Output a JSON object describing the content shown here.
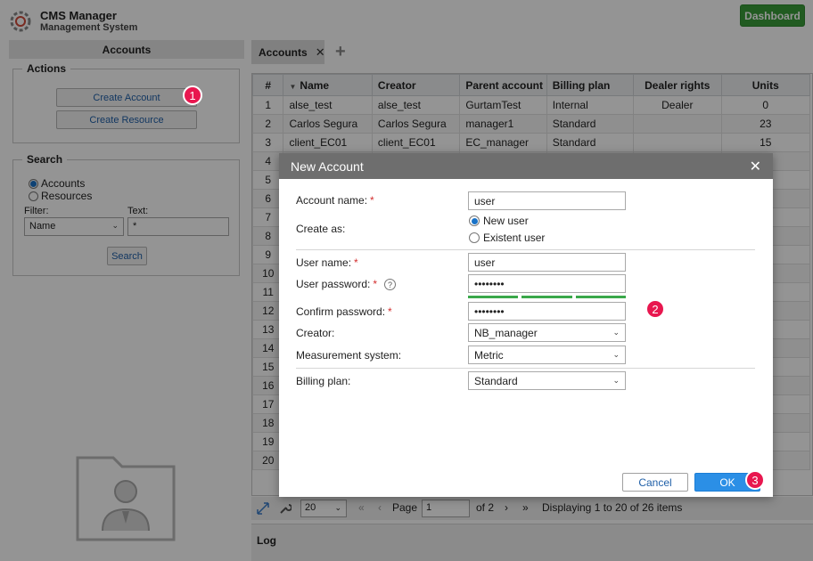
{
  "app": {
    "title": "CMS Manager",
    "subtitle": "Management System",
    "dashboard_label": "Dashboard"
  },
  "left": {
    "header": "Accounts",
    "actions": {
      "legend": "Actions",
      "create_account": "Create Account",
      "create_resource": "Create Resource"
    },
    "search": {
      "legend": "Search",
      "radio_accounts": "Accounts",
      "radio_resources": "Resources",
      "filter_label": "Filter:",
      "text_label": "Text:",
      "filter_value": "Name",
      "text_value": "*",
      "button": "Search"
    }
  },
  "tabs": {
    "accounts": "Accounts",
    "close": "✕",
    "add": "+"
  },
  "table": {
    "columns": [
      "#",
      "Name",
      "Creator",
      "Parent account",
      "Billing plan",
      "Dealer rights",
      "Units"
    ],
    "rows": [
      [
        "1",
        "alse_test",
        "alse_test",
        "GurtamTest",
        "Internal",
        "Dealer",
        "0"
      ],
      [
        "2",
        "Carlos Segura",
        "Carlos Segura",
        "manager1",
        "Standard",
        "",
        "23"
      ],
      [
        "3",
        "client_EC01",
        "client_EC01",
        "EC_manager",
        "Standard",
        "",
        "15"
      ],
      [
        "4",
        "",
        "",
        "",
        "",
        "",
        ""
      ],
      [
        "5",
        "",
        "",
        "",
        "",
        "",
        ""
      ],
      [
        "6",
        "",
        "",
        "",
        "",
        "",
        ""
      ],
      [
        "7",
        "",
        "",
        "",
        "",
        "",
        ""
      ],
      [
        "8",
        "",
        "",
        "",
        "",
        "",
        ""
      ],
      [
        "9",
        "",
        "",
        "",
        "",
        "",
        ""
      ],
      [
        "10",
        "",
        "",
        "",
        "",
        "",
        ""
      ],
      [
        "11",
        "",
        "",
        "",
        "",
        "",
        ""
      ],
      [
        "12",
        "",
        "",
        "",
        "",
        "",
        ""
      ],
      [
        "13",
        "",
        "",
        "",
        "",
        "",
        ""
      ],
      [
        "14",
        "",
        "",
        "",
        "",
        "",
        ""
      ],
      [
        "15",
        "",
        "",
        "",
        "",
        "",
        ""
      ],
      [
        "16",
        "",
        "",
        "",
        "",
        "",
        ""
      ],
      [
        "17",
        "",
        "",
        "",
        "",
        "",
        ""
      ],
      [
        "18",
        "",
        "",
        "",
        "",
        "",
        ""
      ],
      [
        "19",
        "",
        "",
        "",
        "",
        "",
        ""
      ],
      [
        "20",
        "",
        "",
        "",
        "",
        "",
        ""
      ]
    ]
  },
  "pager": {
    "per_page": "20",
    "page_label": "Page",
    "page_value": "1",
    "of_label": "of 2",
    "status": "Displaying 1 to 20 of 26 items"
  },
  "log": {
    "title": "Log"
  },
  "dialog": {
    "title": "New Account",
    "close": "✕",
    "account_name_label": "Account name:",
    "account_name_value": "user",
    "create_as_label": "Create as:",
    "new_user": "New user",
    "existent_user": "Existent user",
    "user_name_label": "User name:",
    "user_name_value": "user",
    "user_password_label": "User password:",
    "user_password_value": "••••••••",
    "help": "?",
    "confirm_password_label": "Confirm password:",
    "confirm_password_value": "••••••••",
    "creator_label": "Creator:",
    "creator_value": "NB_manager",
    "measurement_label": "Measurement system:",
    "measurement_value": "Metric",
    "billing_label": "Billing plan:",
    "billing_value": "Standard",
    "required_mark": "*",
    "cancel": "Cancel",
    "ok": "OK"
  },
  "steps": {
    "one": "1",
    "two": "2",
    "three": "3"
  },
  "colors": {
    "accent": "#2b8fe6",
    "dashboard": "#3a9d3a",
    "marker": "#e8174f",
    "strength": "#3aa84a"
  }
}
